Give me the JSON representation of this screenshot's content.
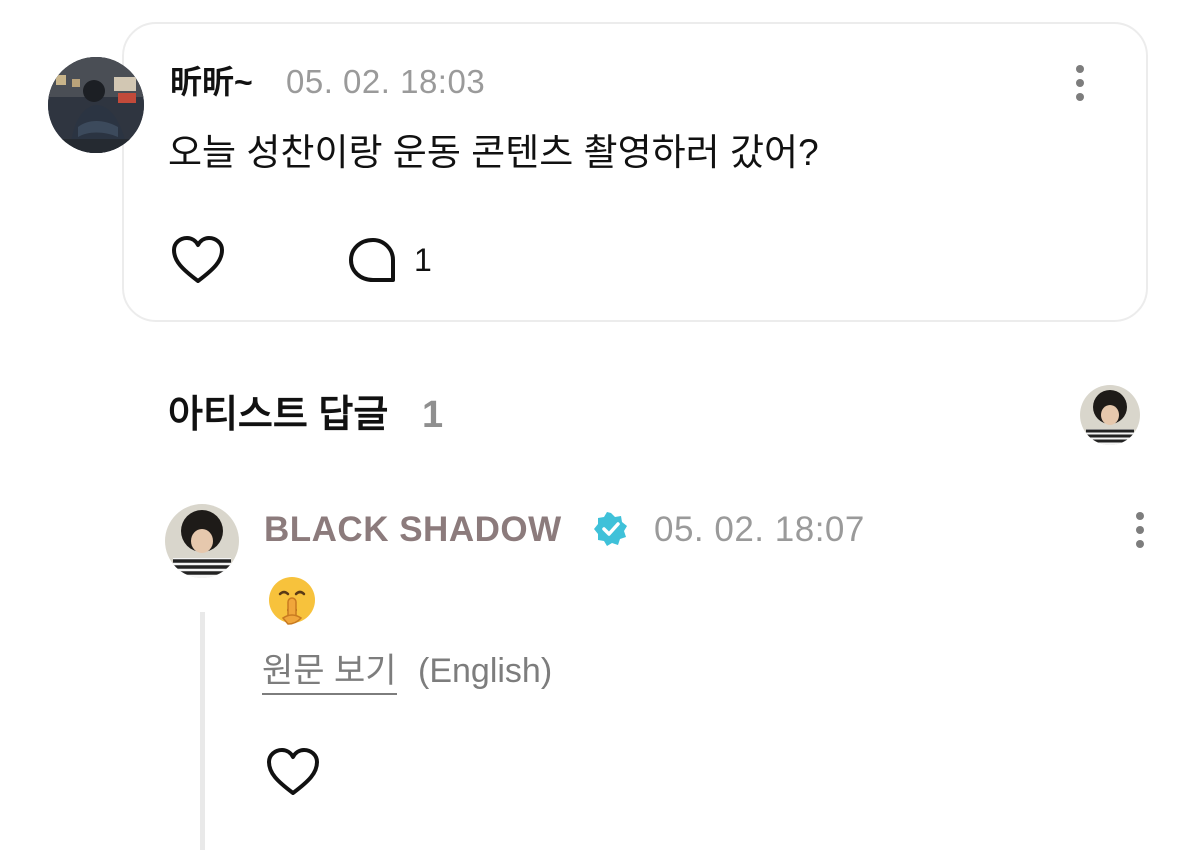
{
  "post": {
    "author": "昕昕~",
    "timestamp": "05. 02. 18:03",
    "body": "오늘 성찬이랑 운동 콘텐츠 촬영하러 갔어?",
    "comment_count": "1",
    "icons": {
      "avatar": "user-avatar",
      "more": "more-vertical-icon",
      "like": "heart-outline-icon",
      "comment": "comment-bubble-icon"
    }
  },
  "artist_replies": {
    "title": "아티스트 답글",
    "count": "1"
  },
  "reply": {
    "author": "BLACK SHADOW",
    "timestamp": "05. 02. 18:07",
    "emoji": "shushing-face",
    "translate_label": "원문 보기",
    "translate_lang": "(English)",
    "author_color": "#8c7b7c",
    "verified_color": "#3fc1d9",
    "icons": {
      "verified": "verified-badge-icon",
      "more": "more-vertical-icon",
      "like": "heart-outline-icon"
    }
  },
  "colors": {
    "text": "#111111",
    "muted": "#9a9a9a",
    "card_border": "#ececec",
    "thread_line": "#e9e9e9"
  }
}
